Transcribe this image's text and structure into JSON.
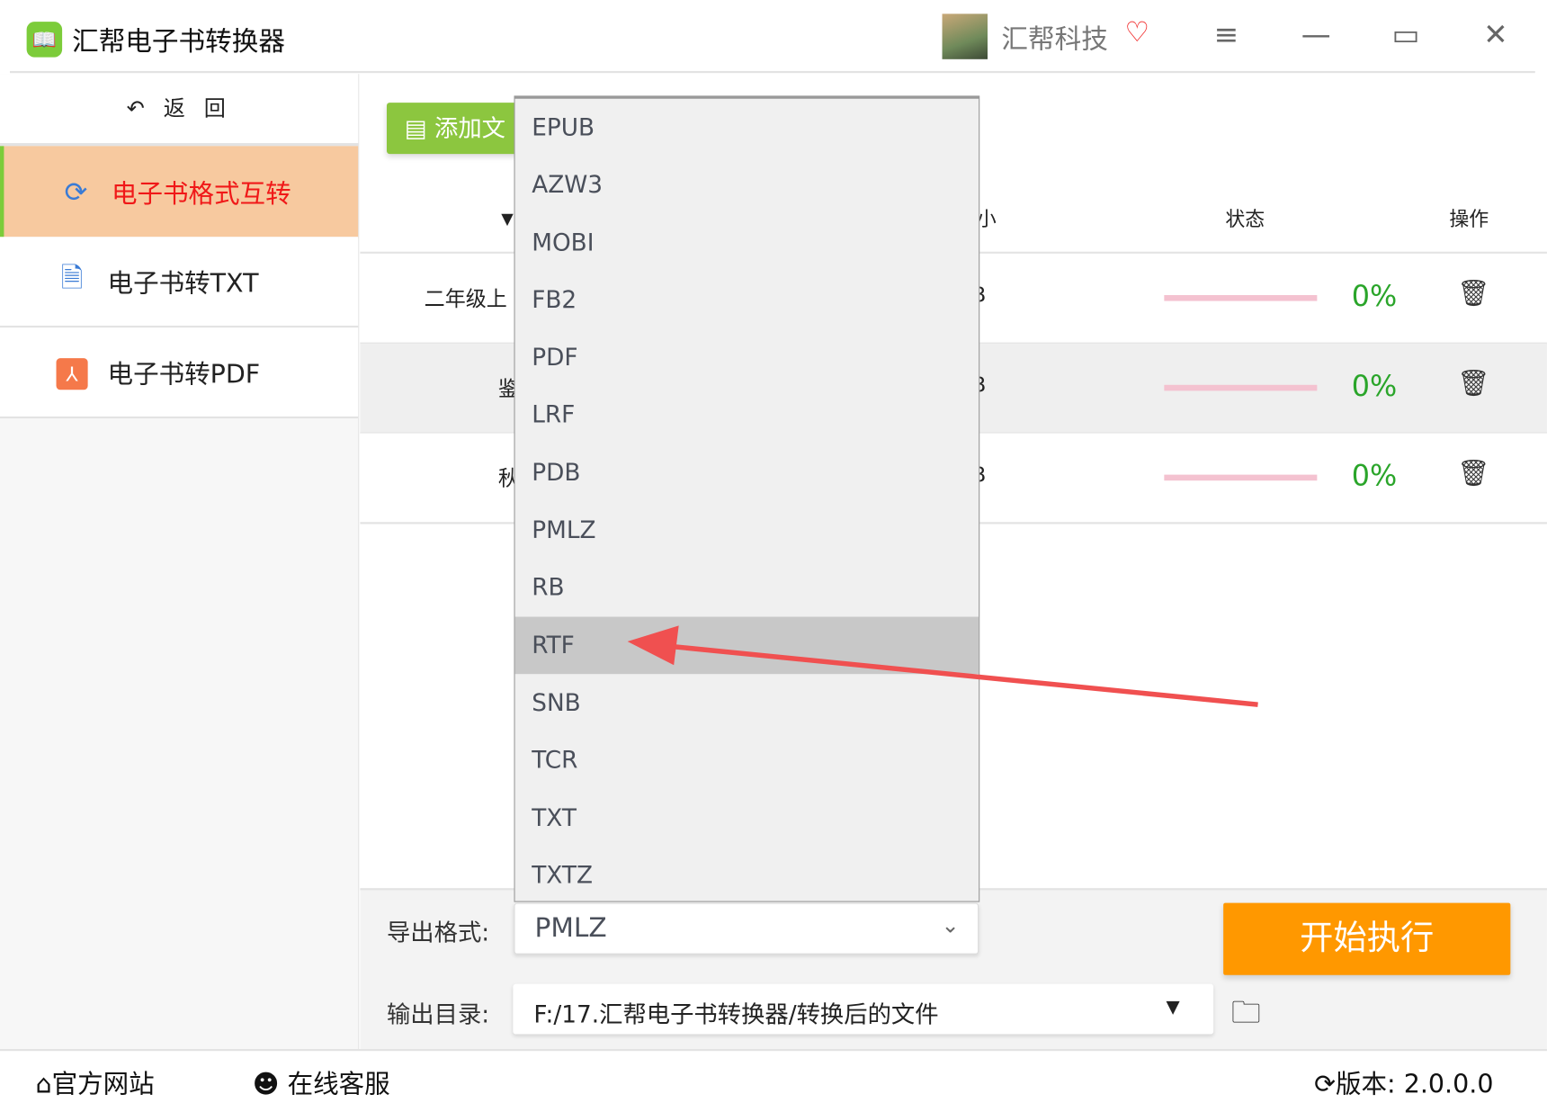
{
  "app": {
    "title": "汇帮电子书转换器",
    "company": "汇帮科技",
    "logo_icon": "book-icon",
    "vip_icon": "heart-v-icon"
  },
  "window_controls": {
    "menu": "≡",
    "minimize": "—",
    "maximize": "▭",
    "close": "✕"
  },
  "sidebar": {
    "back_label": "返 回",
    "items": [
      {
        "label": "电子书格式互转",
        "icon": "refresh-icon",
        "active": true
      },
      {
        "label": "电子书转TXT",
        "icon": "document-icon",
        "active": false
      },
      {
        "label": "电子书转PDF",
        "icon": "pdf-icon",
        "active": false
      }
    ]
  },
  "toolbar": {
    "add_label": "添加文"
  },
  "table": {
    "headers": {
      "size": "小",
      "status": "状态",
      "action": "操作"
    },
    "rows": [
      {
        "name": "二年级上",
        "size": "B",
        "progress": 0,
        "percent": "0%"
      },
      {
        "name": "鉴",
        "size": "B",
        "progress": 0,
        "percent": "0%"
      },
      {
        "name": "秋",
        "size": "B",
        "progress": 0,
        "percent": "0%"
      }
    ]
  },
  "dropdown": {
    "options": [
      "EPUB",
      "AZW3",
      "MOBI",
      "FB2",
      "PDF",
      "LRF",
      "PDB",
      "PMLZ",
      "RB",
      "RTF",
      "SNB",
      "TCR",
      "TXT",
      "TXTZ"
    ],
    "highlighted": "RTF"
  },
  "export": {
    "format_label": "导出格式:",
    "format_value": "PMLZ",
    "dir_label": "输出目录:",
    "dir_value": "F:/17.汇帮电子书转换器/转换后的文件",
    "start_label": "开始执行"
  },
  "footer": {
    "website": "官方网站",
    "support": "在线客服",
    "version_label": "版本:",
    "version": "2.0.0.0"
  },
  "colors": {
    "accent_green": "#8cc63f",
    "active_bg": "#f7c99f",
    "active_text": "#f01818",
    "start_orange": "#ff9800",
    "percent_green": "#2aa52a",
    "annotation_arrow": "#f05050"
  }
}
